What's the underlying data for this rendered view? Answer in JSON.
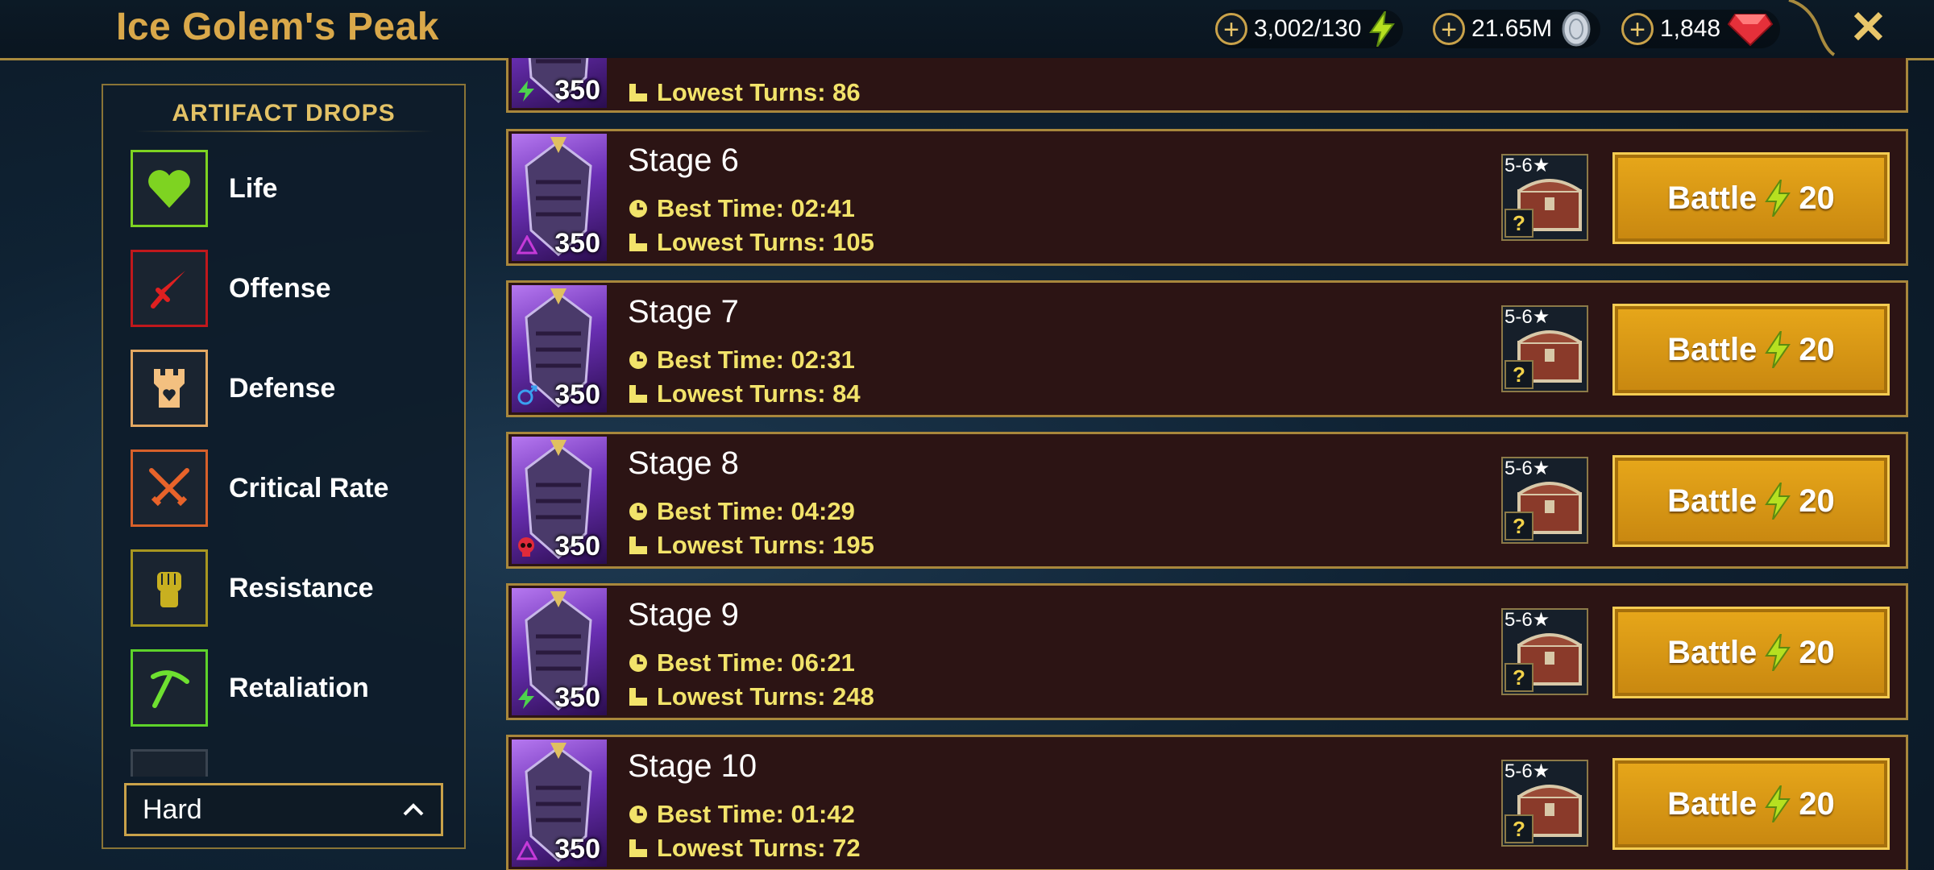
{
  "header": {
    "title": "Ice Golem's Peak",
    "resources": [
      {
        "value": "3,002/130",
        "icon": "energy-icon"
      },
      {
        "value": "21.65M",
        "icon": "silver-icon"
      },
      {
        "value": "1,848",
        "icon": "gem-icon"
      }
    ],
    "close_icon": "close-icon"
  },
  "sidebar": {
    "title": "ARTIFACT DROPS",
    "items": [
      {
        "label": "Life",
        "icon": "heart-icon",
        "color": "#7ed321"
      },
      {
        "label": "Offense",
        "icon": "sword-icon",
        "color": "#e02020"
      },
      {
        "label": "Defense",
        "icon": "tower-icon",
        "color": "#f3c080"
      },
      {
        "label": "Critical Rate",
        "icon": "crossed-swords-icon",
        "color": "#e8632a"
      },
      {
        "label": "Resistance",
        "icon": "fist-icon",
        "color": "#c8b020"
      },
      {
        "label": "Retaliation",
        "icon": "pickaxe-icon",
        "color": "#6ee030"
      }
    ],
    "difficulty": "Hard"
  },
  "stages": {
    "partial": {
      "level": "350",
      "turns_label": "Lowest Turns: 86",
      "affinity": "spirit"
    },
    "rows": [
      {
        "name": "Stage 6",
        "level": "350",
        "best_time": "Best Time: 02:41",
        "lowest_turns": "Lowest Turns: 105",
        "affinity": "magic",
        "reward": "5-6★",
        "q": "?",
        "battle": "Battle",
        "cost": "20"
      },
      {
        "name": "Stage 7",
        "level": "350",
        "best_time": "Best Time: 02:31",
        "lowest_turns": "Lowest Turns: 84",
        "affinity": "force",
        "reward": "5-6★",
        "q": "?",
        "battle": "Battle",
        "cost": "20"
      },
      {
        "name": "Stage 8",
        "level": "350",
        "best_time": "Best Time: 04:29",
        "lowest_turns": "Lowest Turns: 195",
        "affinity": "void",
        "reward": "5-6★",
        "q": "?",
        "battle": "Battle",
        "cost": "20"
      },
      {
        "name": "Stage 9",
        "level": "350",
        "best_time": "Best Time: 06:21",
        "lowest_turns": "Lowest Turns: 248",
        "affinity": "spirit",
        "reward": "5-6★",
        "q": "?",
        "battle": "Battle",
        "cost": "20"
      },
      {
        "name": "Stage 10",
        "level": "350",
        "best_time": "Best Time: 01:42",
        "lowest_turns": "Lowest Turns: 72",
        "affinity": "magic",
        "reward": "5-6★",
        "q": "?",
        "battle": "Battle",
        "cost": "20"
      }
    ]
  }
}
